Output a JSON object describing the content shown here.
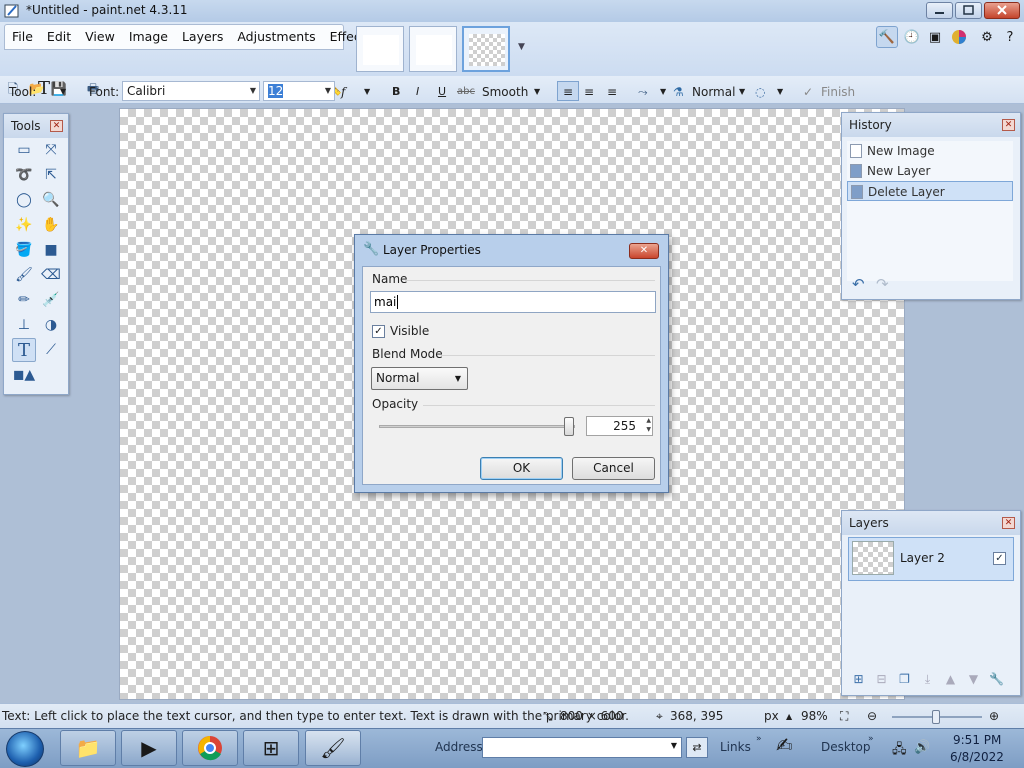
{
  "window": {
    "title": "*Untitled - paint.net 4.3.11"
  },
  "menu": [
    "File",
    "Edit",
    "View",
    "Image",
    "Layers",
    "Adjustments",
    "Effects"
  ],
  "toolbar": {
    "tool_label": "Tool:",
    "font_label": "Font:",
    "font_value": "Calibri",
    "size_value": "12",
    "bold": "B",
    "italic": "I",
    "underline": "U",
    "strike": "abc",
    "antialias": "Smooth",
    "blend": "Normal",
    "finish": "Finish"
  },
  "tools_panel": {
    "title": "Tools"
  },
  "history_panel": {
    "title": "History",
    "items": [
      "New Image",
      "New Layer",
      "Delete Layer"
    ],
    "selected_index": 2
  },
  "layers_panel": {
    "title": "Layers",
    "layers": [
      {
        "name": "Layer 2",
        "visible": true
      }
    ]
  },
  "dialog": {
    "title": "Layer Properties",
    "name_label": "Name",
    "name_value": "mai",
    "visible_label": "Visible",
    "visible_checked": true,
    "blend_label": "Blend Mode",
    "blend_value": "Normal",
    "opacity_label": "Opacity",
    "opacity_value": "255",
    "ok": "OK",
    "cancel": "Cancel"
  },
  "status": {
    "hint": "Text: Left click to place the text cursor, and then type to enter text. Text is drawn with the primary color.",
    "image_size": "800 × 600",
    "cursor_pos": "368, 395",
    "units": "px",
    "zoom": "98%"
  },
  "taskbar": {
    "address_label": "Address",
    "links_label": "Links",
    "desktop_label": "Desktop",
    "time": "9:51 PM",
    "date": "6/8/2022"
  },
  "colors": {
    "accent": "#3c7fb1",
    "close_red": "#c4442c",
    "selection": "#cfe1f7"
  }
}
